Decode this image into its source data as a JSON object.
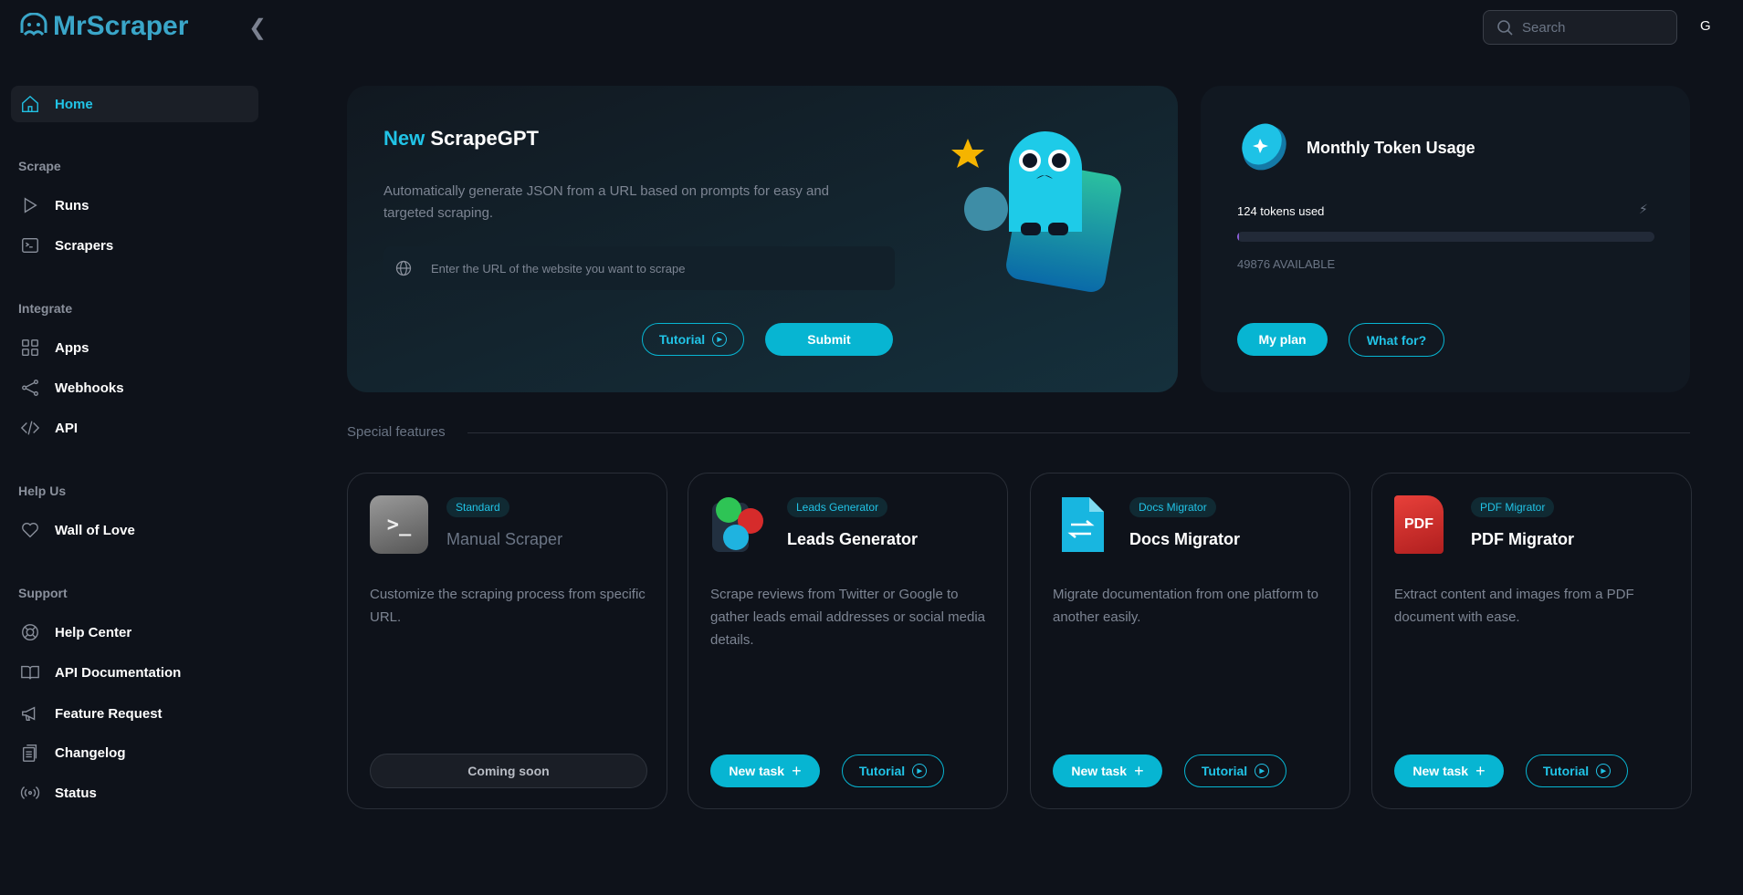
{
  "brand": {
    "name": "MrScraper"
  },
  "header": {
    "search_placeholder": "Search",
    "avatar": "G"
  },
  "sidebar": {
    "home": "Home",
    "sections": [
      {
        "title": "Scrape",
        "items": [
          "Runs",
          "Scrapers"
        ]
      },
      {
        "title": "Integrate",
        "items": [
          "Apps",
          "Webhooks",
          "API"
        ]
      },
      {
        "title": "Help Us",
        "items": [
          "Wall of Love"
        ]
      },
      {
        "title": "Support",
        "items": [
          "Help Center",
          "API Documentation",
          "Feature Request",
          "Changelog",
          "Status"
        ]
      }
    ]
  },
  "hero": {
    "title_accent": "New",
    "title": "ScrapeGPT",
    "description": "Automatically generate JSON from a URL based on prompts for easy and targeted scraping.",
    "url_placeholder": "Enter the URL of the website you want to scrape",
    "tutorial": "Tutorial",
    "submit": "Submit"
  },
  "token": {
    "title": "Monthly Token Usage",
    "used": "124 tokens used",
    "available": "49876 AVAILABLE",
    "used_fraction": 0.0025,
    "my_plan": "My plan",
    "what_for": "What for?"
  },
  "features": {
    "heading": "Special features",
    "cards": [
      {
        "badge": "Standard",
        "title": "Manual Scraper",
        "description": "Customize the scraping process from specific URL.",
        "action": "Coming soon"
      },
      {
        "badge": "Leads Generator",
        "title": "Leads Generator",
        "description": "Scrape reviews from Twitter or Google to gather leads email addresses or social media details.",
        "new_task": "New task",
        "tutorial": "Tutorial"
      },
      {
        "badge": "Docs Migrator",
        "title": "Docs Migrator",
        "description": "Migrate documentation from one platform to another easily.",
        "new_task": "New task",
        "tutorial": "Tutorial"
      },
      {
        "badge": "PDF Migrator",
        "title": "PDF Migrator",
        "description": "Extract content and images from a PDF document with ease.",
        "new_task": "New task",
        "tutorial": "Tutorial",
        "icon_text": "PDF"
      }
    ]
  },
  "colors": {
    "accent": "#07b5d2",
    "background": "#0e121a"
  }
}
